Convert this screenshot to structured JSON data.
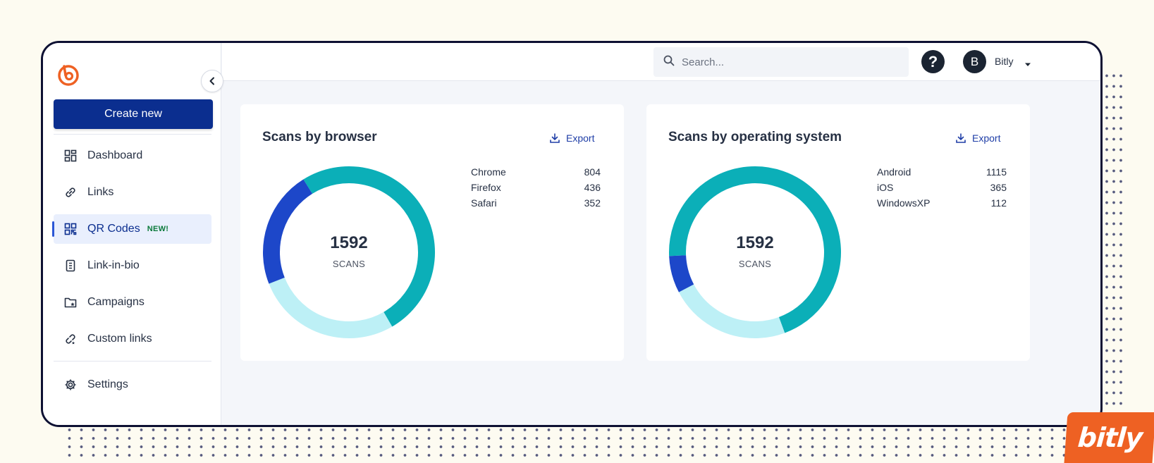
{
  "sidebar": {
    "logo": "bitly-logo-icon",
    "create_label": "Create new",
    "items": [
      {
        "label": "Dashboard",
        "icon": "dashboard-icon"
      },
      {
        "label": "Links",
        "icon": "link-icon"
      },
      {
        "label": "QR Codes",
        "icon": "qr-code-icon",
        "badge": "NEW!",
        "active": true
      },
      {
        "label": "Link-in-bio",
        "icon": "document-icon"
      },
      {
        "label": "Campaigns",
        "icon": "campaign-folder-icon"
      },
      {
        "label": "Custom links",
        "icon": "custom-link-icon"
      }
    ],
    "settings_label": "Settings"
  },
  "topbar": {
    "search_placeholder": "Search...",
    "help_icon": "help-icon",
    "avatar_initial": "B",
    "username": "Bitly"
  },
  "cards": [
    {
      "title": "Scans by browser",
      "export_label": "Export",
      "total": "1592",
      "total_label": "SCANS",
      "legend": [
        {
          "name": "Chrome",
          "value": "804"
        },
        {
          "name": "Firefox",
          "value": "436"
        },
        {
          "name": "Safari",
          "value": "352"
        }
      ]
    },
    {
      "title": "Scans by operating system",
      "export_label": "Export",
      "total": "1592",
      "total_label": "SCANS",
      "legend": [
        {
          "name": "Android",
          "value": "1115"
        },
        {
          "name": "iOS",
          "value": "365"
        },
        {
          "name": "WindowsXP",
          "value": "112"
        }
      ]
    }
  ],
  "chart_data": [
    {
      "type": "pie",
      "title": "Scans by browser",
      "categories": [
        "Chrome",
        "Firefox",
        "Safari"
      ],
      "values": [
        804,
        436,
        352
      ],
      "colors": [
        "#0bafb8",
        "#bdf0f6",
        "#1d47c9"
      ],
      "center_value": 1592,
      "center_label": "SCANS"
    },
    {
      "type": "pie",
      "title": "Scans by operating system",
      "categories": [
        "Android",
        "iOS",
        "WindowsXP"
      ],
      "values": [
        1115,
        365,
        112
      ],
      "colors": [
        "#0bafb8",
        "#bdf0f6",
        "#1d47c9"
      ],
      "center_value": 1592,
      "center_label": "SCANS"
    }
  ],
  "brand": {
    "wordmark": "bitly",
    "color": "#ee6123"
  },
  "colors": {
    "primary": "#0b2e8f",
    "accent": "#ee6123",
    "link": "#1f3ea7"
  }
}
